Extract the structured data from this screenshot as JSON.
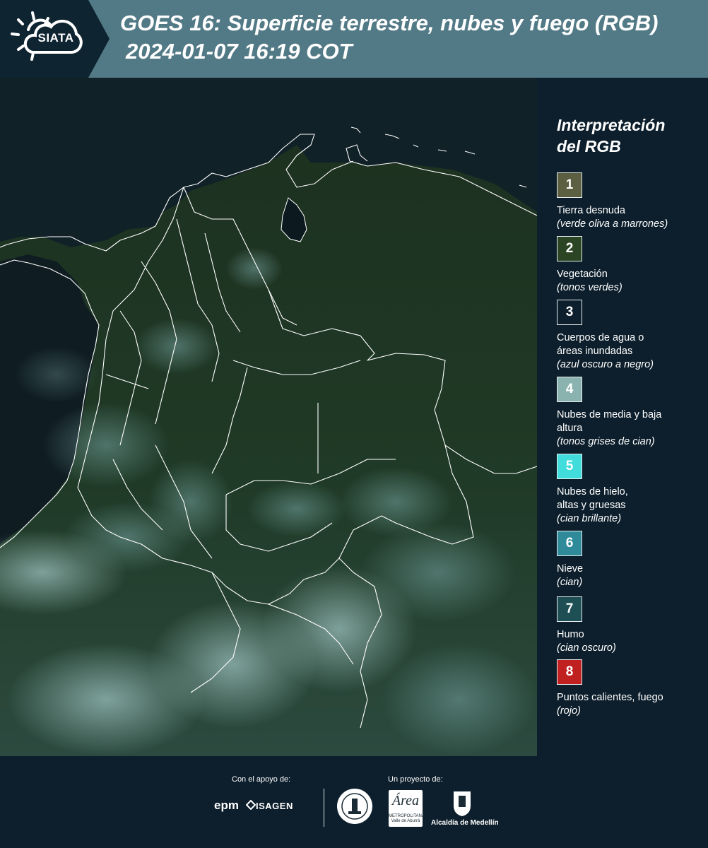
{
  "header": {
    "logo_text": "SIATA",
    "title_line1": "GOES 16: Superficie terrestre, nubes y fuego (RGB)",
    "title_line2": "2024-01-07 16:19 COT"
  },
  "legend": {
    "title_line1": "Interpretación",
    "title_line2": "del RGB",
    "items": [
      {
        "num": "1",
        "color": "#5c5f41",
        "label": "Tierra desnuda",
        "sub": "(verde oliva a marrones)"
      },
      {
        "num": "2",
        "color": "#2b4423",
        "label": "Vegetación",
        "sub": "(tonos verdes)"
      },
      {
        "num": "3",
        "color": "#0d1f2c",
        "label": "Cuerpos de agua o áreas inundadas",
        "sub": "(azul oscuro a negro)"
      },
      {
        "num": "4",
        "color": "#8ab3b0",
        "label": "Nubes de media y baja altura",
        "sub": "(tonos grises de cian)"
      },
      {
        "num": "5",
        "color": "#41dcdc",
        "label": "Nubes de hielo, altas y gruesas",
        "sub": "(cian brillante)"
      },
      {
        "num": "6",
        "color": "#2f8a9a",
        "label": "Nieve",
        "sub": "(cian)"
      },
      {
        "num": "7",
        "color": "#1d4f54",
        "label": "Humo",
        "sub": "(cian oscuro)"
      },
      {
        "num": "8",
        "color": "#c0201f",
        "label": "Puntos calientes, fuego",
        "sub": "(rojo)"
      }
    ]
  },
  "footer": {
    "support_caption": "Con el apoyo de:",
    "project_caption": "Un proyecto de:",
    "sponsor1": "epm",
    "sponsor2": "ISAGEN",
    "area_logo_text": "Área",
    "area_logo_sub": "METROPOLITANA Valle de Aburrá",
    "alcaldia": "Alcaldía de Medellín"
  }
}
